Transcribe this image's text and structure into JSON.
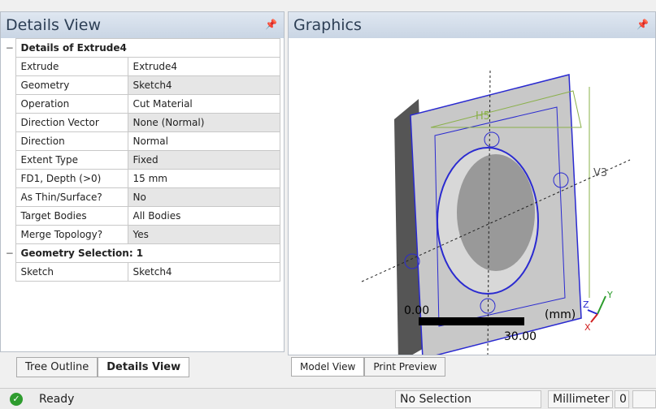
{
  "left_panel": {
    "title": "Details View",
    "pin": "pin-icon",
    "group1": "Details of Extrude4",
    "rows": [
      {
        "key": "Extrude",
        "value": "Extrude4"
      },
      {
        "key": "Geometry",
        "value": "Sketch4"
      },
      {
        "key": "Operation",
        "value": "Cut Material"
      },
      {
        "key": "Direction Vector",
        "value": "None (Normal)"
      },
      {
        "key": "Direction",
        "value": "Normal"
      },
      {
        "key": "Extent Type",
        "value": "Fixed"
      },
      {
        "key": "FD1, Depth (>0)",
        "value": "15 mm"
      },
      {
        "key": "As Thin/Surface?",
        "value": "No"
      },
      {
        "key": "Target Bodies",
        "value": "All Bodies"
      },
      {
        "key": "Merge Topology?",
        "value": "Yes"
      }
    ],
    "group2": "Geometry Selection: 1",
    "rows2": [
      {
        "key": "Sketch",
        "value": "Sketch4"
      }
    ],
    "tabs": [
      "Tree Outline",
      "Details View"
    ]
  },
  "graphics": {
    "title": "Graphics",
    "scale_start": "0.00",
    "scale_end": "30.00",
    "units": "(mm)",
    "dims": [
      "H5",
      "V3"
    ],
    "axes": {
      "x": "X",
      "y": "Y",
      "z": "Z"
    },
    "tabs": [
      "Model View",
      "Print Preview"
    ]
  },
  "status": {
    "text": "Ready",
    "selection": "No Selection",
    "units": "Millimeter",
    "value": "0"
  }
}
